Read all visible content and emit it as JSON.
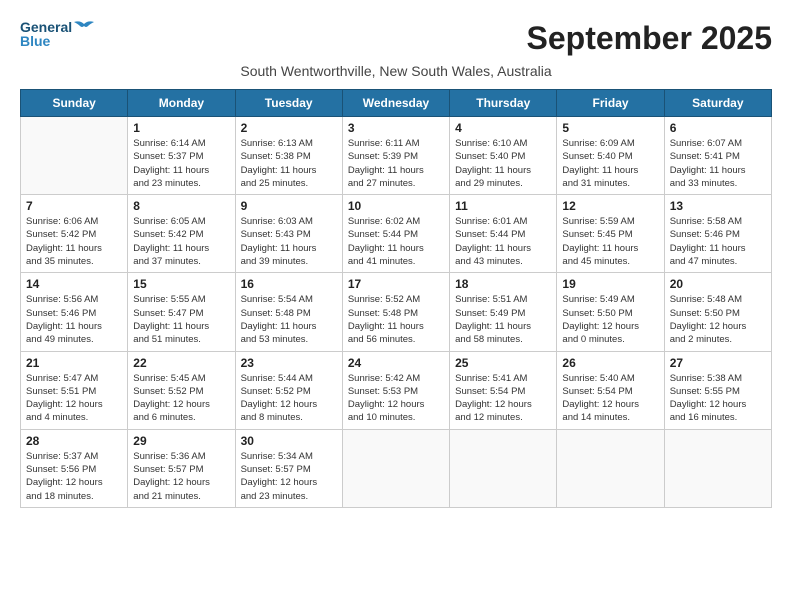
{
  "header": {
    "logo_general": "General",
    "logo_blue": "Blue",
    "month_title": "September 2025",
    "subtitle": "South Wentworthville, New South Wales, Australia"
  },
  "days_of_week": [
    "Sunday",
    "Monday",
    "Tuesday",
    "Wednesday",
    "Thursday",
    "Friday",
    "Saturday"
  ],
  "weeks": [
    [
      {
        "day": "",
        "info": ""
      },
      {
        "day": "1",
        "info": "Sunrise: 6:14 AM\nSunset: 5:37 PM\nDaylight: 11 hours\nand 23 minutes."
      },
      {
        "day": "2",
        "info": "Sunrise: 6:13 AM\nSunset: 5:38 PM\nDaylight: 11 hours\nand 25 minutes."
      },
      {
        "day": "3",
        "info": "Sunrise: 6:11 AM\nSunset: 5:39 PM\nDaylight: 11 hours\nand 27 minutes."
      },
      {
        "day": "4",
        "info": "Sunrise: 6:10 AM\nSunset: 5:40 PM\nDaylight: 11 hours\nand 29 minutes."
      },
      {
        "day": "5",
        "info": "Sunrise: 6:09 AM\nSunset: 5:40 PM\nDaylight: 11 hours\nand 31 minutes."
      },
      {
        "day": "6",
        "info": "Sunrise: 6:07 AM\nSunset: 5:41 PM\nDaylight: 11 hours\nand 33 minutes."
      }
    ],
    [
      {
        "day": "7",
        "info": "Sunrise: 6:06 AM\nSunset: 5:42 PM\nDaylight: 11 hours\nand 35 minutes."
      },
      {
        "day": "8",
        "info": "Sunrise: 6:05 AM\nSunset: 5:42 PM\nDaylight: 11 hours\nand 37 minutes."
      },
      {
        "day": "9",
        "info": "Sunrise: 6:03 AM\nSunset: 5:43 PM\nDaylight: 11 hours\nand 39 minutes."
      },
      {
        "day": "10",
        "info": "Sunrise: 6:02 AM\nSunset: 5:44 PM\nDaylight: 11 hours\nand 41 minutes."
      },
      {
        "day": "11",
        "info": "Sunrise: 6:01 AM\nSunset: 5:44 PM\nDaylight: 11 hours\nand 43 minutes."
      },
      {
        "day": "12",
        "info": "Sunrise: 5:59 AM\nSunset: 5:45 PM\nDaylight: 11 hours\nand 45 minutes."
      },
      {
        "day": "13",
        "info": "Sunrise: 5:58 AM\nSunset: 5:46 PM\nDaylight: 11 hours\nand 47 minutes."
      }
    ],
    [
      {
        "day": "14",
        "info": "Sunrise: 5:56 AM\nSunset: 5:46 PM\nDaylight: 11 hours\nand 49 minutes."
      },
      {
        "day": "15",
        "info": "Sunrise: 5:55 AM\nSunset: 5:47 PM\nDaylight: 11 hours\nand 51 minutes."
      },
      {
        "day": "16",
        "info": "Sunrise: 5:54 AM\nSunset: 5:48 PM\nDaylight: 11 hours\nand 53 minutes."
      },
      {
        "day": "17",
        "info": "Sunrise: 5:52 AM\nSunset: 5:48 PM\nDaylight: 11 hours\nand 56 minutes."
      },
      {
        "day": "18",
        "info": "Sunrise: 5:51 AM\nSunset: 5:49 PM\nDaylight: 11 hours\nand 58 minutes."
      },
      {
        "day": "19",
        "info": "Sunrise: 5:49 AM\nSunset: 5:50 PM\nDaylight: 12 hours\nand 0 minutes."
      },
      {
        "day": "20",
        "info": "Sunrise: 5:48 AM\nSunset: 5:50 PM\nDaylight: 12 hours\nand 2 minutes."
      }
    ],
    [
      {
        "day": "21",
        "info": "Sunrise: 5:47 AM\nSunset: 5:51 PM\nDaylight: 12 hours\nand 4 minutes."
      },
      {
        "day": "22",
        "info": "Sunrise: 5:45 AM\nSunset: 5:52 PM\nDaylight: 12 hours\nand 6 minutes."
      },
      {
        "day": "23",
        "info": "Sunrise: 5:44 AM\nSunset: 5:52 PM\nDaylight: 12 hours\nand 8 minutes."
      },
      {
        "day": "24",
        "info": "Sunrise: 5:42 AM\nSunset: 5:53 PM\nDaylight: 12 hours\nand 10 minutes."
      },
      {
        "day": "25",
        "info": "Sunrise: 5:41 AM\nSunset: 5:54 PM\nDaylight: 12 hours\nand 12 minutes."
      },
      {
        "day": "26",
        "info": "Sunrise: 5:40 AM\nSunset: 5:54 PM\nDaylight: 12 hours\nand 14 minutes."
      },
      {
        "day": "27",
        "info": "Sunrise: 5:38 AM\nSunset: 5:55 PM\nDaylight: 12 hours\nand 16 minutes."
      }
    ],
    [
      {
        "day": "28",
        "info": "Sunrise: 5:37 AM\nSunset: 5:56 PM\nDaylight: 12 hours\nand 18 minutes."
      },
      {
        "day": "29",
        "info": "Sunrise: 5:36 AM\nSunset: 5:57 PM\nDaylight: 12 hours\nand 21 minutes."
      },
      {
        "day": "30",
        "info": "Sunrise: 5:34 AM\nSunset: 5:57 PM\nDaylight: 12 hours\nand 23 minutes."
      },
      {
        "day": "",
        "info": ""
      },
      {
        "day": "",
        "info": ""
      },
      {
        "day": "",
        "info": ""
      },
      {
        "day": "",
        "info": ""
      }
    ]
  ]
}
